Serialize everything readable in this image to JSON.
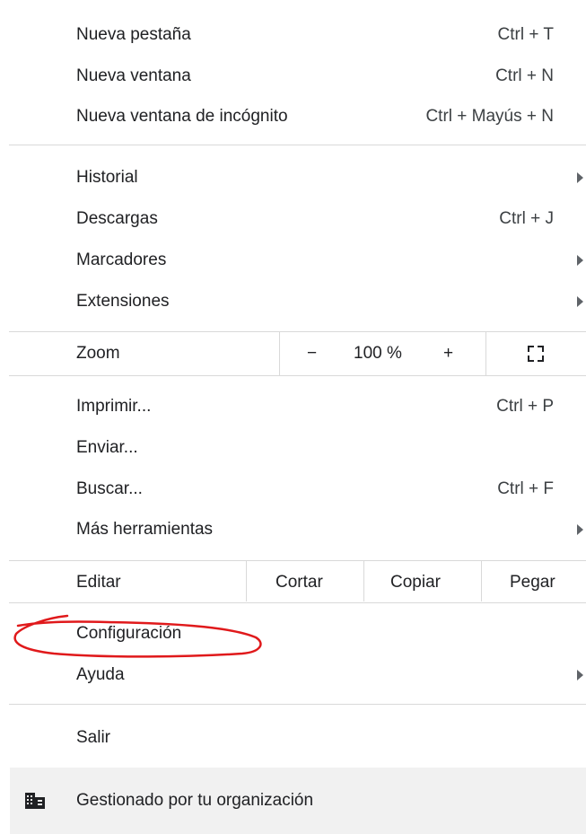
{
  "menu": {
    "items": [
      {
        "label": "Nueva pestaña",
        "shortcut": "Ctrl + T"
      },
      {
        "label": "Nueva ventana",
        "shortcut": "Ctrl + N"
      },
      {
        "label": "Nueva ventana de incógnito",
        "shortcut": "Ctrl + Mayús + N"
      },
      {
        "label": "Historial"
      },
      {
        "label": "Descargas",
        "shortcut": "Ctrl + J"
      },
      {
        "label": "Marcadores"
      },
      {
        "label": "Extensiones"
      },
      {
        "label": "Imprimir...",
        "shortcut": "Ctrl + P"
      },
      {
        "label": "Enviar..."
      },
      {
        "label": "Buscar...",
        "shortcut": "Ctrl + F"
      },
      {
        "label": "Más herramientas"
      },
      {
        "label": "Configuración"
      },
      {
        "label": "Ayuda"
      },
      {
        "label": "Salir"
      }
    ],
    "zoom": {
      "label": "Zoom",
      "minus": "−",
      "value": "100 %",
      "plus": "+"
    },
    "edit": {
      "label": "Editar",
      "cut": "Cortar",
      "copy": "Copiar",
      "paste": "Pegar"
    },
    "managed": {
      "label": "Gestionado por tu organización"
    }
  },
  "colors": {
    "annotation": "#e0191b",
    "separator": "#d9d9d9",
    "managed_bg": "#f1f1f1"
  }
}
